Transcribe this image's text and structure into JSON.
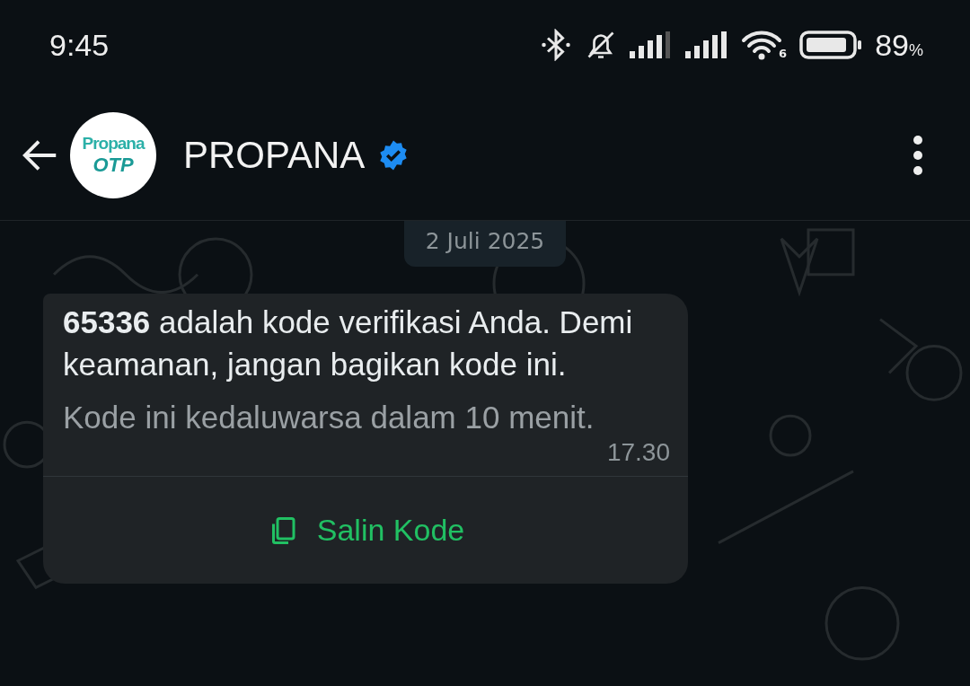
{
  "status_bar": {
    "time": "9:45",
    "battery_percent": "89",
    "battery_unit": "%",
    "wifi_badge": "6"
  },
  "header": {
    "avatar_text": "Propana",
    "avatar_subtext": "OTP",
    "title": "PROPANA",
    "verified": true
  },
  "date_chip": "2 Juli 2025",
  "message": {
    "text": "**65336** adalah kode verifikasi Anda. Demi keamanan, jangan bagikan kode ini.",
    "footer": "Kode ini kedaluwarsa dalam 10 menit.",
    "time": "17.30",
    "button": "Salin Kode"
  }
}
